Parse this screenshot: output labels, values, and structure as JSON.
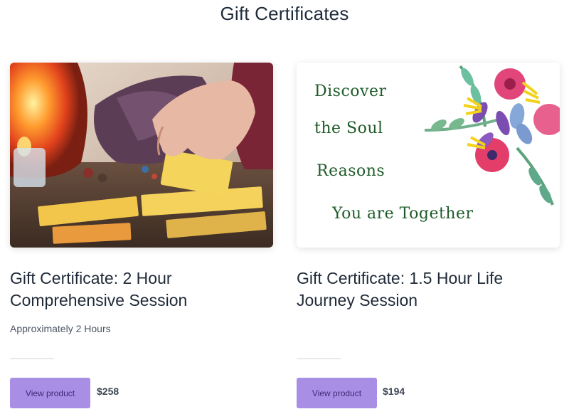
{
  "page": {
    "title": "Gift Certificates"
  },
  "products": [
    {
      "title": "Gift Certificate: 2 Hour Comprehensive Session",
      "subtitle": "Approximately 2 Hours",
      "button_label": "View product",
      "price": "$258"
    },
    {
      "title": "Gift Certificate: 1.5 Hour Life Journey Session",
      "subtitle": "",
      "button_label": "View product",
      "price": "$194",
      "image_text": {
        "line1": "Discover",
        "line2": "the Soul",
        "line3": "Reasons",
        "line4": "You are Together"
      }
    }
  ],
  "colors": {
    "button_bg": "#a98ee6",
    "button_text": "#3e2a74",
    "heading": "#1d2b3a"
  }
}
